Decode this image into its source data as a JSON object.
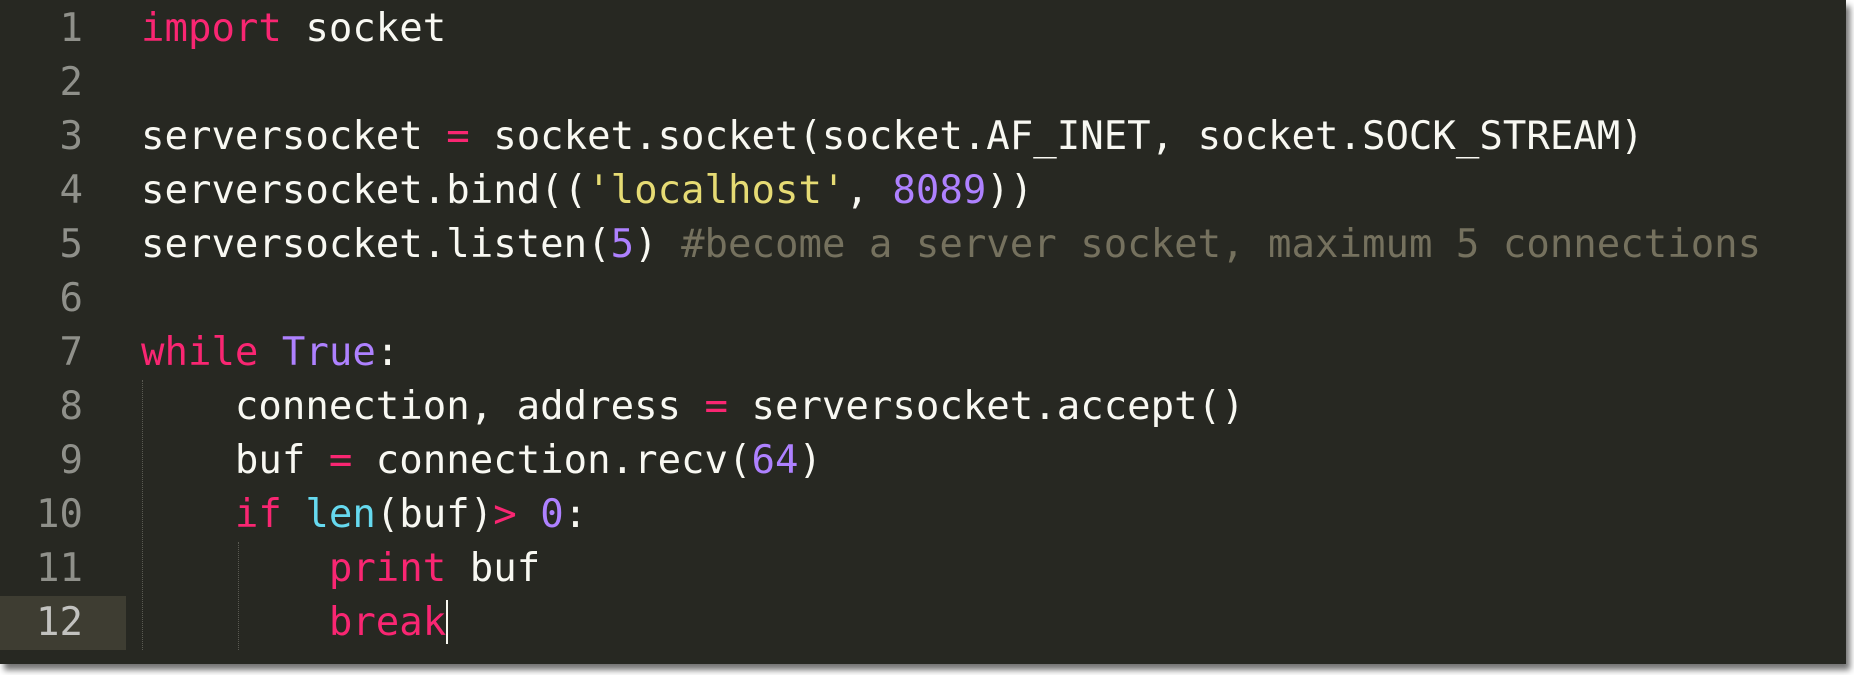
{
  "editor": {
    "theme_colors": {
      "background": "#272822",
      "keyword": "#f92672",
      "constant": "#ae81ff",
      "string": "#e6db74",
      "builtin": "#66d9ef",
      "comment": "#75715e",
      "text": "#f8f8f2"
    },
    "active_line": 12,
    "lines": [
      {
        "num": "1",
        "tokens": [
          [
            "kw",
            "import"
          ],
          [
            "plain",
            " socket"
          ]
        ]
      },
      {
        "num": "2",
        "tokens": []
      },
      {
        "num": "3",
        "tokens": [
          [
            "plain",
            "serversocket "
          ],
          [
            "op",
            "="
          ],
          [
            "plain",
            " socket.socket(socket.AF_INET, socket.SOCK_STREAM)"
          ]
        ]
      },
      {
        "num": "4",
        "tokens": [
          [
            "plain",
            "serversocket.bind(("
          ],
          [
            "str",
            "'localhost'"
          ],
          [
            "plain",
            ", "
          ],
          [
            "num",
            "8089"
          ],
          [
            "plain",
            "))"
          ]
        ]
      },
      {
        "num": "5",
        "tokens": [
          [
            "plain",
            "serversocket.listen("
          ],
          [
            "num",
            "5"
          ],
          [
            "plain",
            ") "
          ],
          [
            "comment",
            "#become a server socket, maximum 5 connections"
          ]
        ]
      },
      {
        "num": "6",
        "tokens": []
      },
      {
        "num": "7",
        "tokens": [
          [
            "kw",
            "while"
          ],
          [
            "plain",
            " "
          ],
          [
            "const",
            "True"
          ],
          [
            "plain",
            ":"
          ]
        ]
      },
      {
        "num": "8",
        "tokens": [
          [
            "plain",
            "    connection, address "
          ],
          [
            "op",
            "="
          ],
          [
            "plain",
            " serversocket.accept()"
          ]
        ]
      },
      {
        "num": "9",
        "tokens": [
          [
            "plain",
            "    buf "
          ],
          [
            "op",
            "="
          ],
          [
            "plain",
            " connection.recv("
          ],
          [
            "num",
            "64"
          ],
          [
            "plain",
            ")"
          ]
        ]
      },
      {
        "num": "10",
        "tokens": [
          [
            "plain",
            "    "
          ],
          [
            "kw",
            "if"
          ],
          [
            "plain",
            " "
          ],
          [
            "builtin",
            "len"
          ],
          [
            "plain",
            "(buf)"
          ],
          [
            "op",
            ">"
          ],
          [
            "plain",
            " "
          ],
          [
            "num",
            "0"
          ],
          [
            "plain",
            ":"
          ]
        ]
      },
      {
        "num": "11",
        "tokens": [
          [
            "plain",
            "        "
          ],
          [
            "kw",
            "print"
          ],
          [
            "plain",
            " buf"
          ]
        ]
      },
      {
        "num": "12",
        "tokens": [
          [
            "plain",
            "        "
          ],
          [
            "kw",
            "break"
          ]
        ]
      }
    ]
  }
}
